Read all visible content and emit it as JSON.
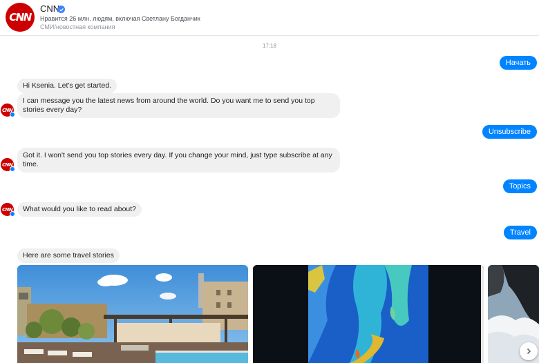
{
  "header": {
    "logo_text": "CNN",
    "page_name": "CNN",
    "likes": "Нравится 26 млн. людям, включая Светлану Богданчик",
    "category": "СМИ/новостная компания"
  },
  "timestamp": "17:18",
  "messages": [
    {
      "sender": "user",
      "text": "Начать"
    },
    {
      "sender": "bot",
      "text": "Hi Ksenia. Let's get started."
    },
    {
      "sender": "bot",
      "text": "I can message you the latest news from around the world. Do you want me to send you top stories every day?"
    },
    {
      "sender": "user",
      "text": "Unsubscribe"
    },
    {
      "sender": "bot",
      "text": "Got it. I won't send you top stories every day. If you change your mind, just type subscribe at any time."
    },
    {
      "sender": "user",
      "text": "Topics"
    },
    {
      "sender": "bot",
      "text": "What would you like to read about?"
    },
    {
      "sender": "user",
      "text": "Travel"
    },
    {
      "sender": "bot",
      "text": "Here are some travel stories"
    }
  ],
  "avatar_text": "CNN",
  "carousel": {
    "icon": "chevron-right-icon"
  },
  "colors": {
    "cnn_red": "#cc0000",
    "messenger_blue": "#0084ff",
    "incoming_bubble": "#f1f0f0",
    "verified_blue": "#4080ff"
  }
}
